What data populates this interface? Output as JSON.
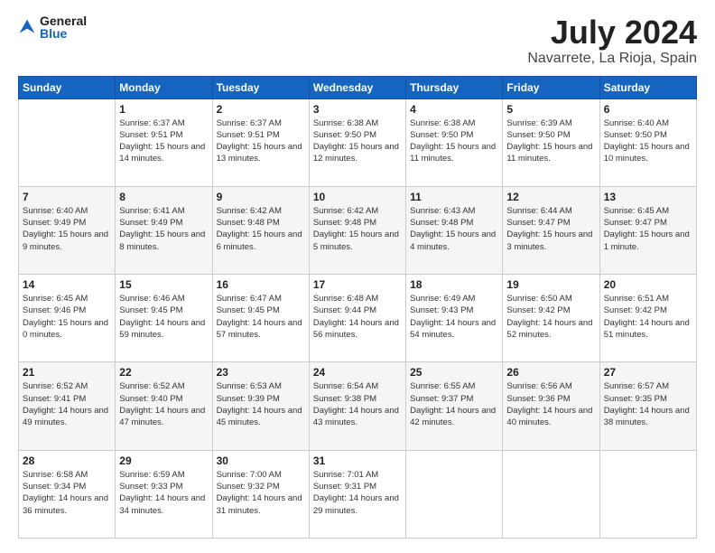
{
  "header": {
    "logo": {
      "general": "General",
      "blue": "Blue"
    },
    "title": "July 2024",
    "location": "Navarrete, La Rioja, Spain"
  },
  "calendar": {
    "days_of_week": [
      "Sunday",
      "Monday",
      "Tuesday",
      "Wednesday",
      "Thursday",
      "Friday",
      "Saturday"
    ],
    "weeks": [
      [
        {
          "day": "",
          "sunrise": "",
          "sunset": "",
          "daylight": ""
        },
        {
          "day": "1",
          "sunrise": "Sunrise: 6:37 AM",
          "sunset": "Sunset: 9:51 PM",
          "daylight": "Daylight: 15 hours and 14 minutes."
        },
        {
          "day": "2",
          "sunrise": "Sunrise: 6:37 AM",
          "sunset": "Sunset: 9:51 PM",
          "daylight": "Daylight: 15 hours and 13 minutes."
        },
        {
          "day": "3",
          "sunrise": "Sunrise: 6:38 AM",
          "sunset": "Sunset: 9:50 PM",
          "daylight": "Daylight: 15 hours and 12 minutes."
        },
        {
          "day": "4",
          "sunrise": "Sunrise: 6:38 AM",
          "sunset": "Sunset: 9:50 PM",
          "daylight": "Daylight: 15 hours and 11 minutes."
        },
        {
          "day": "5",
          "sunrise": "Sunrise: 6:39 AM",
          "sunset": "Sunset: 9:50 PM",
          "daylight": "Daylight: 15 hours and 11 minutes."
        },
        {
          "day": "6",
          "sunrise": "Sunrise: 6:40 AM",
          "sunset": "Sunset: 9:50 PM",
          "daylight": "Daylight: 15 hours and 10 minutes."
        }
      ],
      [
        {
          "day": "7",
          "sunrise": "Sunrise: 6:40 AM",
          "sunset": "Sunset: 9:49 PM",
          "daylight": "Daylight: 15 hours and 9 minutes."
        },
        {
          "day": "8",
          "sunrise": "Sunrise: 6:41 AM",
          "sunset": "Sunset: 9:49 PM",
          "daylight": "Daylight: 15 hours and 8 minutes."
        },
        {
          "day": "9",
          "sunrise": "Sunrise: 6:42 AM",
          "sunset": "Sunset: 9:48 PM",
          "daylight": "Daylight: 15 hours and 6 minutes."
        },
        {
          "day": "10",
          "sunrise": "Sunrise: 6:42 AM",
          "sunset": "Sunset: 9:48 PM",
          "daylight": "Daylight: 15 hours and 5 minutes."
        },
        {
          "day": "11",
          "sunrise": "Sunrise: 6:43 AM",
          "sunset": "Sunset: 9:48 PM",
          "daylight": "Daylight: 15 hours and 4 minutes."
        },
        {
          "day": "12",
          "sunrise": "Sunrise: 6:44 AM",
          "sunset": "Sunset: 9:47 PM",
          "daylight": "Daylight: 15 hours and 3 minutes."
        },
        {
          "day": "13",
          "sunrise": "Sunrise: 6:45 AM",
          "sunset": "Sunset: 9:47 PM",
          "daylight": "Daylight: 15 hours and 1 minute."
        }
      ],
      [
        {
          "day": "14",
          "sunrise": "Sunrise: 6:45 AM",
          "sunset": "Sunset: 9:46 PM",
          "daylight": "Daylight: 15 hours and 0 minutes."
        },
        {
          "day": "15",
          "sunrise": "Sunrise: 6:46 AM",
          "sunset": "Sunset: 9:45 PM",
          "daylight": "Daylight: 14 hours and 59 minutes."
        },
        {
          "day": "16",
          "sunrise": "Sunrise: 6:47 AM",
          "sunset": "Sunset: 9:45 PM",
          "daylight": "Daylight: 14 hours and 57 minutes."
        },
        {
          "day": "17",
          "sunrise": "Sunrise: 6:48 AM",
          "sunset": "Sunset: 9:44 PM",
          "daylight": "Daylight: 14 hours and 56 minutes."
        },
        {
          "day": "18",
          "sunrise": "Sunrise: 6:49 AM",
          "sunset": "Sunset: 9:43 PM",
          "daylight": "Daylight: 14 hours and 54 minutes."
        },
        {
          "day": "19",
          "sunrise": "Sunrise: 6:50 AM",
          "sunset": "Sunset: 9:42 PM",
          "daylight": "Daylight: 14 hours and 52 minutes."
        },
        {
          "day": "20",
          "sunrise": "Sunrise: 6:51 AM",
          "sunset": "Sunset: 9:42 PM",
          "daylight": "Daylight: 14 hours and 51 minutes."
        }
      ],
      [
        {
          "day": "21",
          "sunrise": "Sunrise: 6:52 AM",
          "sunset": "Sunset: 9:41 PM",
          "daylight": "Daylight: 14 hours and 49 minutes."
        },
        {
          "day": "22",
          "sunrise": "Sunrise: 6:52 AM",
          "sunset": "Sunset: 9:40 PM",
          "daylight": "Daylight: 14 hours and 47 minutes."
        },
        {
          "day": "23",
          "sunrise": "Sunrise: 6:53 AM",
          "sunset": "Sunset: 9:39 PM",
          "daylight": "Daylight: 14 hours and 45 minutes."
        },
        {
          "day": "24",
          "sunrise": "Sunrise: 6:54 AM",
          "sunset": "Sunset: 9:38 PM",
          "daylight": "Daylight: 14 hours and 43 minutes."
        },
        {
          "day": "25",
          "sunrise": "Sunrise: 6:55 AM",
          "sunset": "Sunset: 9:37 PM",
          "daylight": "Daylight: 14 hours and 42 minutes."
        },
        {
          "day": "26",
          "sunrise": "Sunrise: 6:56 AM",
          "sunset": "Sunset: 9:36 PM",
          "daylight": "Daylight: 14 hours and 40 minutes."
        },
        {
          "day": "27",
          "sunrise": "Sunrise: 6:57 AM",
          "sunset": "Sunset: 9:35 PM",
          "daylight": "Daylight: 14 hours and 38 minutes."
        }
      ],
      [
        {
          "day": "28",
          "sunrise": "Sunrise: 6:58 AM",
          "sunset": "Sunset: 9:34 PM",
          "daylight": "Daylight: 14 hours and 36 minutes."
        },
        {
          "day": "29",
          "sunrise": "Sunrise: 6:59 AM",
          "sunset": "Sunset: 9:33 PM",
          "daylight": "Daylight: 14 hours and 34 minutes."
        },
        {
          "day": "30",
          "sunrise": "Sunrise: 7:00 AM",
          "sunset": "Sunset: 9:32 PM",
          "daylight": "Daylight: 14 hours and 31 minutes."
        },
        {
          "day": "31",
          "sunrise": "Sunrise: 7:01 AM",
          "sunset": "Sunset: 9:31 PM",
          "daylight": "Daylight: 14 hours and 29 minutes."
        },
        {
          "day": "",
          "sunrise": "",
          "sunset": "",
          "daylight": ""
        },
        {
          "day": "",
          "sunrise": "",
          "sunset": "",
          "daylight": ""
        },
        {
          "day": "",
          "sunrise": "",
          "sunset": "",
          "daylight": ""
        }
      ]
    ]
  }
}
